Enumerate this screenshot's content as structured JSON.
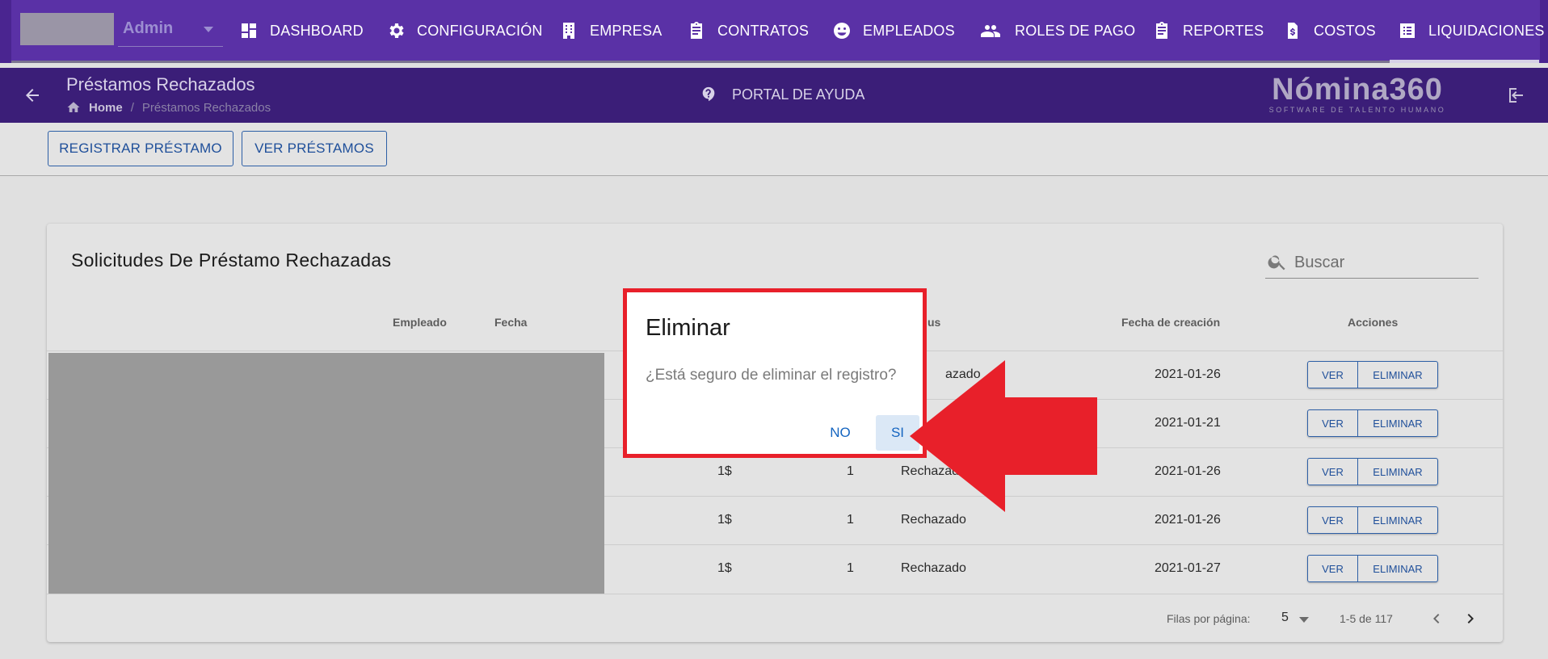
{
  "header": {
    "admin_label": "Admin",
    "nav": [
      {
        "label": "DASHBOARD",
        "icon": "dashboard-icon"
      },
      {
        "label": "CONFIGURACIÓN",
        "icon": "gear-icon"
      },
      {
        "label": "EMPRESA",
        "icon": "building-icon"
      },
      {
        "label": "CONTRATOS",
        "icon": "clipboard-icon"
      },
      {
        "label": "EMPLEADOS",
        "icon": "face-icon"
      },
      {
        "label": "ROLES DE PAGO",
        "icon": "people-icon"
      },
      {
        "label": "REPORTES",
        "icon": "clipboard-icon"
      },
      {
        "label": "COSTOS",
        "icon": "money-document-icon"
      },
      {
        "label": "LIQUIDACIONES",
        "icon": "list-icon"
      }
    ]
  },
  "subheader": {
    "title": "Préstamos Rechazados",
    "breadcrumb_home": "Home",
    "breadcrumb_separator": "/",
    "breadcrumb_current": "Préstamos Rechazados",
    "help_label": "PORTAL DE AYUDA",
    "logo_brand": "Nómina360",
    "logo_tagline": "SOFTWARE DE TALENTO HUMANO"
  },
  "actions": {
    "register_label": "REGISTRAR PRÉSTAMO",
    "view_label": "VER PRÉSTAMOS"
  },
  "card": {
    "title": "Solicitudes De Préstamo Rechazadas",
    "search_placeholder": "Buscar",
    "columns": {
      "employee": "Empleado",
      "date": "Fecha",
      "status_partial": "us",
      "created": "Fecha de creación",
      "actions": "Acciones"
    },
    "rows": [
      {
        "amount": "",
        "qty": "",
        "status": "azado",
        "created": "2021-01-26"
      },
      {
        "amount": "",
        "qty": "",
        "status": "",
        "created": "2021-01-21"
      },
      {
        "amount": "1$",
        "qty": "1",
        "status": "Rechazado",
        "created": "2021-01-26"
      },
      {
        "amount": "1$",
        "qty": "1",
        "status": "Rechazado",
        "created": "2021-01-26"
      },
      {
        "amount": "1$",
        "qty": "1",
        "status": "Rechazado",
        "created": "2021-01-27"
      }
    ],
    "row_buttons": {
      "view": "VER",
      "delete": "ELIMINAR"
    },
    "footer": {
      "rows_per_page_label": "Filas por página:",
      "rows_per_page_value": "5",
      "range": "1-5 de 117"
    }
  },
  "dialog": {
    "title": "Eliminar",
    "message": "¿Está seguro de eliminar el registro?",
    "no_label": "NO",
    "yes_label": "SI"
  },
  "colors": {
    "nav_bg": "#5a31a6",
    "subbar_bg": "#3b1e78",
    "primary_blue": "#1f4f9a",
    "annotation_red": "#e8202a"
  }
}
